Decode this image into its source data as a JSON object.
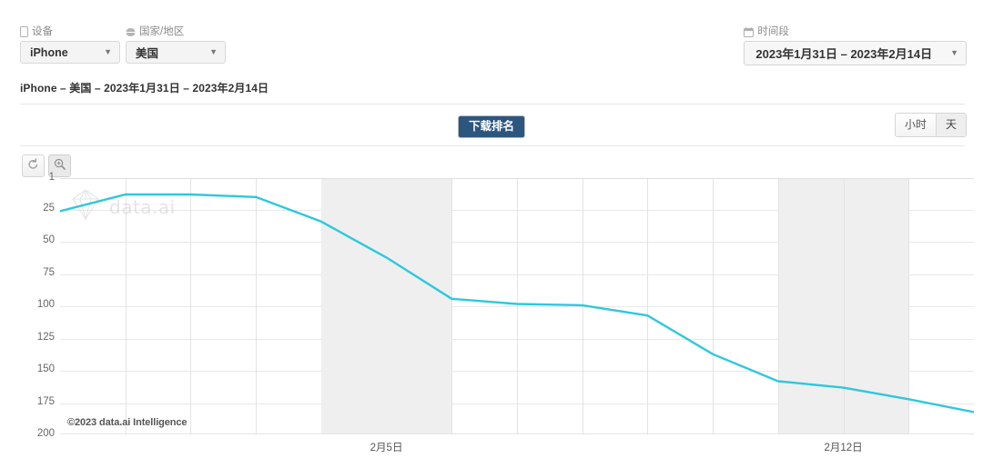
{
  "filters": {
    "device": {
      "label": "设备",
      "icon": "device-icon",
      "value": "iPhone"
    },
    "country": {
      "label": "国家/地区",
      "icon": "globe-icon",
      "value": "美国"
    },
    "daterange": {
      "label": "时间段",
      "icon": "calendar-icon",
      "value": "2023年1月31日 – 2023年2月14日"
    }
  },
  "summary": "iPhone – 美国 – 2023年1月31日 – 2023年2月14日",
  "metric": {
    "badge_label": "下载排名"
  },
  "granularity": {
    "hour_label": "小时",
    "day_label": "天",
    "selected": "天"
  },
  "chart_toolbar": {
    "reset_label": "reset-zoom",
    "zoom_label": "zoom-select",
    "reset_icon": "reset-arrow-icon",
    "zoom_icon": "magnifier-icon"
  },
  "watermark": {
    "text": "data.ai",
    "logo": "data-ai-diamond-logo"
  },
  "copyright": "©2023 data.ai Intelligence",
  "colors": {
    "line": "#2ec8dd",
    "badge_bg": "#2d567e",
    "band": "#efefef",
    "grid": "#e5e5e5"
  },
  "chart_data": {
    "type": "line",
    "title": "下载排名",
    "xlabel": "",
    "ylabel": "",
    "grid": true,
    "legend_position": "none",
    "y_inverted": true,
    "ylim": [
      1,
      200
    ],
    "yticks": [
      1,
      25,
      50,
      75,
      100,
      125,
      150,
      175,
      200
    ],
    "x": [
      "2023-01-31",
      "2023-02-01",
      "2023-02-02",
      "2023-02-03",
      "2023-02-04",
      "2023-02-05",
      "2023-02-06",
      "2023-02-07",
      "2023-02-08",
      "2023-02-09",
      "2023-02-10",
      "2023-02-11",
      "2023-02-12",
      "2023-02-13",
      "2023-02-14"
    ],
    "xtick_labels": [
      "2月5日",
      "2月12日"
    ],
    "xtick_indices": [
      5,
      12
    ],
    "weekend_bands": [
      [
        4,
        6
      ],
      [
        11,
        13
      ]
    ],
    "series": [
      {
        "name": "下载排名",
        "color": "#2ec8dd",
        "values": [
          26,
          13,
          13,
          15,
          34,
          62,
          94,
          98,
          99,
          107,
          137,
          158,
          163,
          172,
          182
        ]
      }
    ]
  }
}
